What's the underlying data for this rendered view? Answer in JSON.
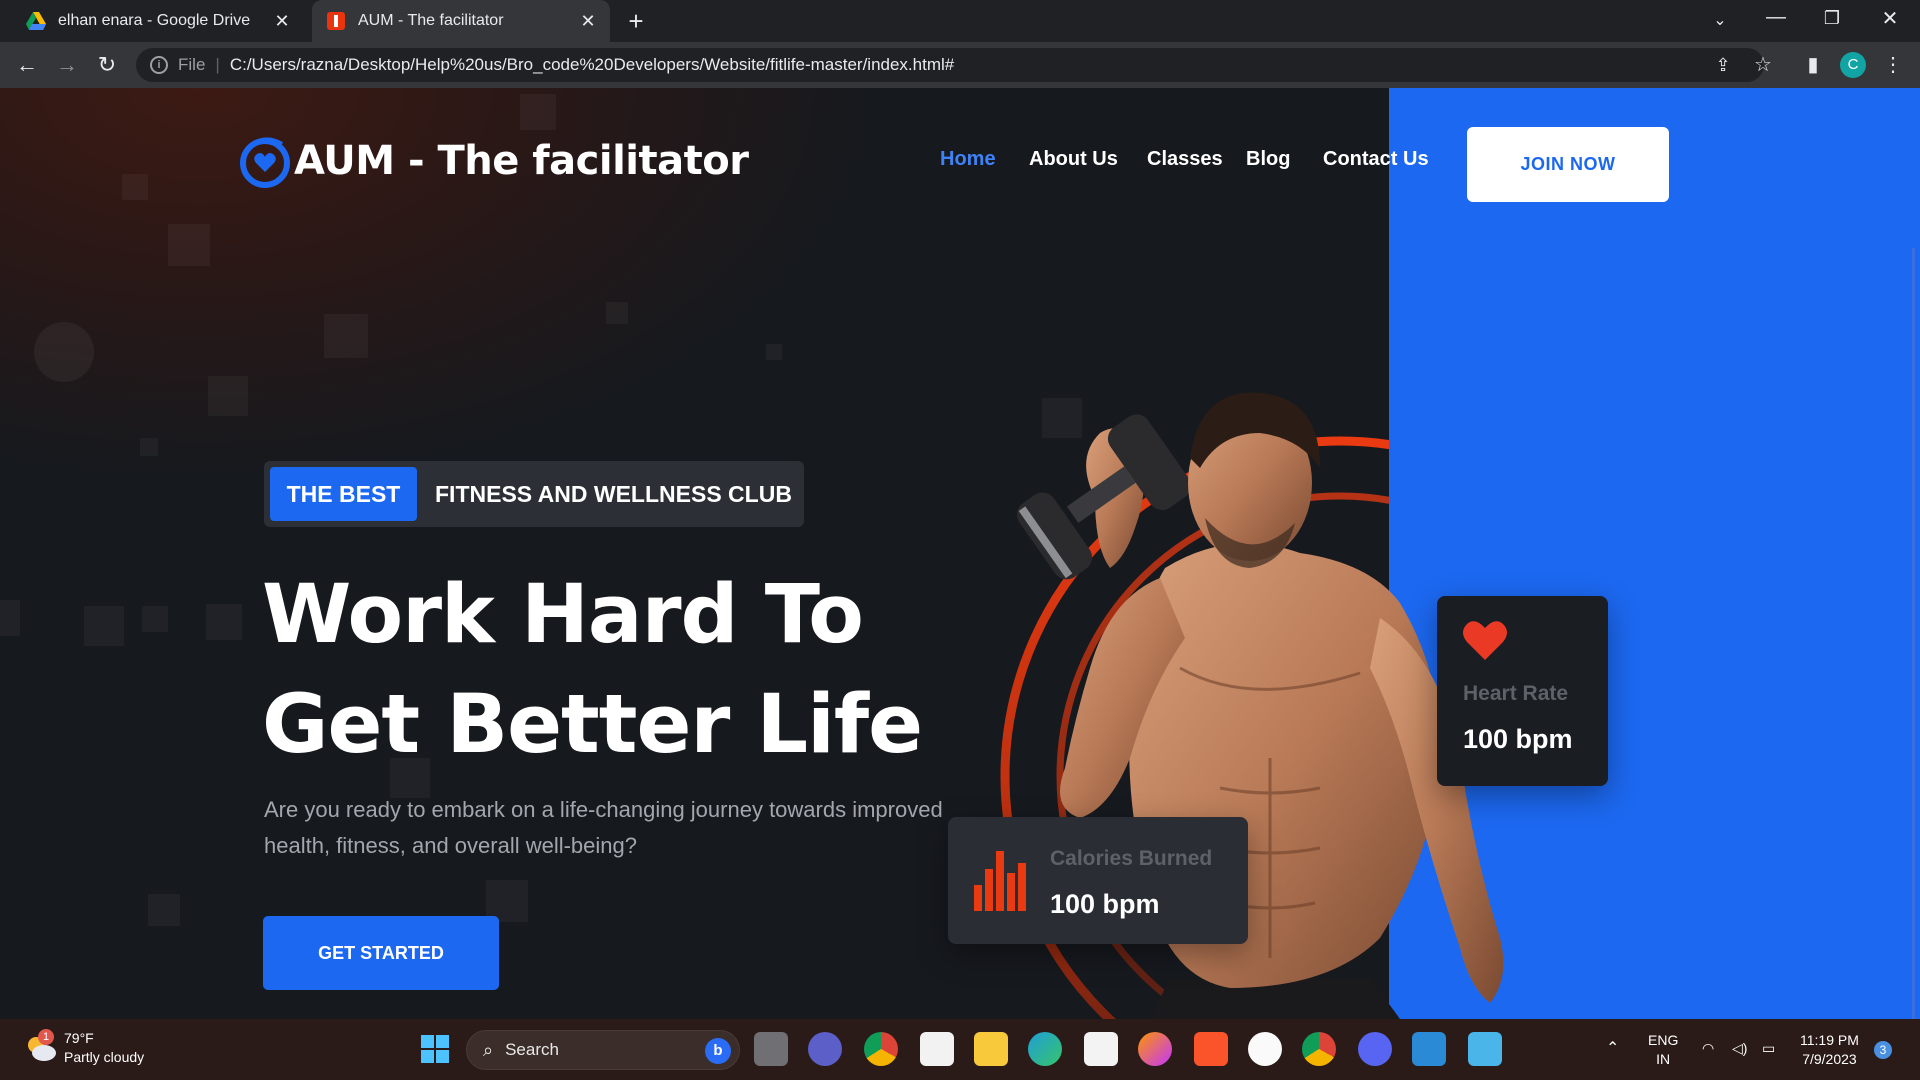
{
  "browser": {
    "tabs": [
      {
        "title": "elhan enara - Google Drive",
        "icon": "google-drive-icon",
        "active": false
      },
      {
        "title": "AUM - The facilitator",
        "icon": "site-favicon",
        "active": true
      }
    ],
    "address": {
      "scheme": "File",
      "url": "C:/Users/razna/Desktop/Help%20us/Bro_code%20Developers/Website/fitlife-master/index.html#"
    },
    "profile_initial": "C"
  },
  "site": {
    "brand": "AUM - The facilitator",
    "nav": [
      {
        "label": "Home",
        "active": true
      },
      {
        "label": "About Us",
        "active": false
      },
      {
        "label": "Classes",
        "active": false
      },
      {
        "label": "Blog",
        "active": false
      },
      {
        "label": "Contact Us",
        "active": false
      }
    ],
    "join_label": "JOIN NOW",
    "badge": {
      "highlight": "THE BEST",
      "text": "FITNESS AND WELLNESS CLUB"
    },
    "headline": [
      "Work Hard To",
      "Get Better Life"
    ],
    "lead": "Are you ready to embark on a life-changing journey towards improved health, fitness, and overall well-being?",
    "cta_label": "GET STARTED",
    "cards": {
      "heart_rate": {
        "label": "Heart Rate",
        "value": "100 bpm"
      },
      "calories": {
        "label": "Calories Burned",
        "value": "100 bpm"
      }
    },
    "colors": {
      "accent": "#1c68f0",
      "ring": "#e8340f",
      "background": "#16191e"
    }
  },
  "taskbar": {
    "weather": {
      "temp": "79°F",
      "condition": "Partly cloudy",
      "alert_count": "1"
    },
    "search_placeholder": "Search",
    "apps": [
      "start-icon",
      "task-view-icon",
      "teams-icon",
      "chrome-icon",
      "calendar-app-icon",
      "file-explorer-icon",
      "edge-icon",
      "store-icon",
      "firefox-icon",
      "brave-icon",
      "itunes-icon",
      "chrome-active-icon",
      "discord-icon",
      "vscode-icon",
      "notepad-icon"
    ],
    "tray": {
      "lang1": "ENG",
      "lang2": "IN",
      "time": "11:19 PM",
      "date": "7/9/2023",
      "notifications": "3"
    }
  }
}
